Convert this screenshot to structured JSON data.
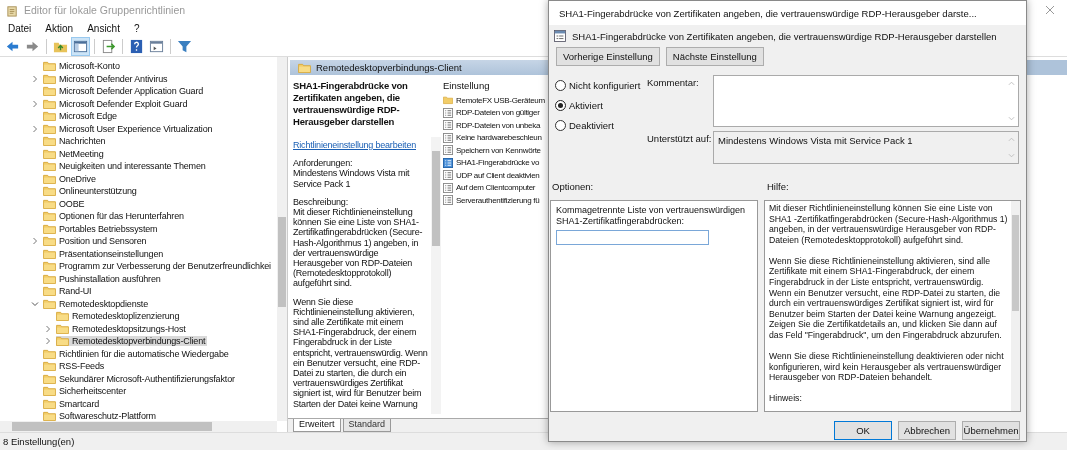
{
  "window": {
    "title": "Editor für lokale Gruppenrichtlinien"
  },
  "menu": [
    "Datei",
    "Aktion",
    "Ansicht",
    "?"
  ],
  "tree": {
    "items": [
      {
        "label": "Microsoft-Konto",
        "kind": "leaf",
        "selected": false
      },
      {
        "label": "Microsoft Defender Antivirus",
        "kind": "branch",
        "expanded": false,
        "selected": false
      },
      {
        "label": "Microsoft Defender Application Guard",
        "kind": "leaf",
        "selected": false
      },
      {
        "label": "Microsoft Defender Exploit Guard",
        "kind": "branch",
        "expanded": false,
        "selected": false
      },
      {
        "label": "Microsoft Edge",
        "kind": "leaf",
        "selected": false
      },
      {
        "label": "Microsoft User Experience Virtualization",
        "kind": "branch",
        "expanded": false,
        "selected": false
      },
      {
        "label": "Nachrichten",
        "kind": "leaf",
        "selected": false
      },
      {
        "label": "NetMeeting",
        "kind": "leaf",
        "selected": false
      },
      {
        "label": "Neuigkeiten und interessante Themen",
        "kind": "leaf",
        "selected": false
      },
      {
        "label": "OneDrive",
        "kind": "leaf",
        "selected": false
      },
      {
        "label": "Onlineunterstützung",
        "kind": "leaf",
        "selected": false
      },
      {
        "label": "OOBE",
        "kind": "leaf",
        "selected": false
      },
      {
        "label": "Optionen für das Herunterfahren",
        "kind": "leaf",
        "selected": false
      },
      {
        "label": "Portables Betriebssystem",
        "kind": "leaf",
        "selected": false
      },
      {
        "label": "Position und Sensoren",
        "kind": "branch",
        "expanded": false,
        "selected": false
      },
      {
        "label": "Präsentationseinstellungen",
        "kind": "leaf",
        "selected": false
      },
      {
        "label": "Programm zur Verbesserung der Benutzerfreundlichkei",
        "kind": "leaf",
        "selected": false
      },
      {
        "label": "Pushinstallation ausführen",
        "kind": "leaf",
        "selected": false
      },
      {
        "label": "Rand-UI",
        "kind": "leaf",
        "selected": false
      },
      {
        "label": "Remotedesktopdienste",
        "kind": "branch",
        "expanded": true,
        "selected": false,
        "children": [
          {
            "label": "Remotedesktoplizenzierung",
            "kind": "leaf",
            "selected": false
          },
          {
            "label": "Remotedesktopsitzungs-Host",
            "kind": "branch",
            "expanded": false,
            "selected": false
          },
          {
            "label": "Remotedesktopverbindungs-Client",
            "kind": "branch",
            "expanded": false,
            "selected": true
          }
        ]
      },
      {
        "label": "Richtlinien für die automatische Wiedergabe",
        "kind": "leaf",
        "selected": false
      },
      {
        "label": "RSS-Feeds",
        "kind": "leaf",
        "selected": false
      },
      {
        "label": "Sekundärer Microsoft-Authentifizierungsfaktor",
        "kind": "leaf",
        "selected": false
      },
      {
        "label": "Sicherheitscenter",
        "kind": "leaf",
        "selected": false
      },
      {
        "label": "Smartcard",
        "kind": "leaf",
        "selected": false
      },
      {
        "label": "Softwareschutz-Plattform",
        "kind": "leaf",
        "selected": false
      }
    ]
  },
  "details": {
    "header": "Remotedesktopverbindungs-Client",
    "policy_title": "SHA1-Fingerabdrücke von Zertifikaten angeben, die vertrauenswürdige RDP-Herausgeber darstellen",
    "edit_link": "Richtlinieneinstellung bearbeiten",
    "requirements_label": "Anforderungen:",
    "requirements": "Mindestens Windows Vista mit Service Pack 1",
    "description_label": "Beschreibung:",
    "paragraphs": [
      "Mit dieser Richtlinieneinstellung können Sie eine Liste von SHA1-Zertifikatfingerabdrücken (Secure-Hash-Algorithmus 1) angeben, in der vertrauenswürdige Herausgeber von RDP-Dateien (Remotedesktopprotokoll) aufgeführt sind.",
      "Wenn Sie diese Richtlinieneinstellung aktivieren, sind alle Zertifikate mit einem SHA1-Fingerabdruck, der einem Fingerabdruck in der Liste entspricht, vertrauenswürdig. Wenn ein Benutzer versucht, eine RDP-Datei zu starten, die durch ein vertrauenswürdiges Zertifikat signiert ist, wird für Benutzer beim Starten der Datei keine Warnung"
    ],
    "column_header": "Einstellung",
    "settings": [
      {
        "label": "RemoteFX USB-Geräteum",
        "kind": "folder"
      },
      {
        "label": "RDP-Dateien von gültiger",
        "kind": "policy"
      },
      {
        "label": "RDP-Dateien von unbeka",
        "kind": "policy"
      },
      {
        "label": "Keine hardwarebeschleun",
        "kind": "policy"
      },
      {
        "label": "Speichern von Kennwörte",
        "kind": "policy"
      },
      {
        "label": "SHA1-Fingerabdrücke vo",
        "kind": "policy-open"
      },
      {
        "label": "UDP auf Client deaktivien",
        "kind": "policy"
      },
      {
        "label": "Auf dem Clientcomputer",
        "kind": "policy"
      },
      {
        "label": "Serverauthentifizierung fü",
        "kind": "policy"
      }
    ],
    "tabs": [
      {
        "label": "Erweitert",
        "selected": true
      },
      {
        "label": "Standard",
        "selected": false
      }
    ]
  },
  "status_bar": "8 Einstellung(en)",
  "dialog": {
    "title": "SHA1-Fingerabdrücke von Zertifikaten angeben, die vertrauenswürdige RDP-Herausgeber darste...",
    "heading": "SHA1-Fingerabdrücke von Zertifikaten angeben, die vertrauenswürdige RDP-Herausgeber darstellen",
    "nav_buttons": [
      "Vorherige Einstellung",
      "Nächste Einstellung"
    ],
    "states": [
      {
        "label": "Nicht konfiguriert",
        "selected": false
      },
      {
        "label": "Aktiviert",
        "selected": true
      },
      {
        "label": "Deaktiviert",
        "selected": false
      }
    ],
    "comment_label": "Kommentar:",
    "supported_label": "Unterstützt auf:",
    "supported_value": "Mindestens Windows Vista mit Service Pack 1",
    "options_label": "Optionen:",
    "help_label": "Hilfe:",
    "option_field_label": "Kommagetrennte Liste von vertrauenswürdigen SHA1-Zertifikatfingerabdrücken:",
    "help_paragraphs": [
      "Mit dieser Richtlinieneinstellung können Sie eine Liste von SHA1 -Zertifikatfingerabdrücken (Secure-Hash-Algorithmus 1) angeben, in der vertrauenswürdige Herausgeber von RDP-Dateien (Remotedesktopprotokoll) aufgeführt sind.",
      "Wenn Sie diese Richtlinieneinstellung aktivieren, sind alle Zertifikate mit einem SHA1-Fingerabdruck, der einem Fingerabdruck in der Liste entspricht, vertrauenswürdig. Wenn ein Benutzer versucht, eine RDP-Datei zu starten, die durch ein vertrauenswürdiges Zertifikat signiert ist, wird für Benutzer beim Starten der Datei keine Warnung angezeigt. Zeigen Sie die Zertifikatdetails an, und klicken Sie dann auf das Feld \"Fingerabdruck\", um den Fingerabdruck abzurufen.",
      "Wenn Sie diese Richtlinieneinstellung deaktivieren oder nicht konfigurieren, wird kein Herausgeber als vertrauenswürdiger Herausgeber von RDP-Dateien behandelt.",
      "Hinweis:"
    ],
    "buttons": [
      "OK",
      "Abbrechen",
      "Übernehmen"
    ]
  }
}
